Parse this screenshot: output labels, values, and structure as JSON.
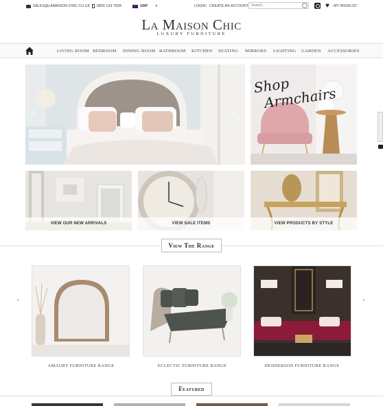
{
  "topbar": {
    "email": "sales@lamaison-chic.co.uk",
    "separator": "|",
    "phone": "0800 133 7828",
    "currency": "GBP",
    "currency_caret": "▾",
    "login": "Login",
    "create_account": "Create An Account",
    "search_placeholder": "Search...",
    "wishlist": "My Wishlist"
  },
  "logo": {
    "title": "La Maison Chic",
    "subtitle": "Luxury Furniture"
  },
  "nav": {
    "items": [
      "Living Room",
      "Bedroom",
      "Dining Room",
      "Bathroom",
      "Kitchen",
      "Seating",
      "Mirrors",
      "Lighting",
      "Garden",
      "Accessories"
    ]
  },
  "hero": {
    "prev_arrow": "‹",
    "next_arrow": "›"
  },
  "promo": {
    "armchairs_line1": "Shop",
    "armchairs_line2": "Armchairs"
  },
  "tiles": [
    {
      "label": "View our new arrivals"
    },
    {
      "label": "View sale items"
    },
    {
      "label": "View products by style"
    }
  ],
  "view_range": {
    "title": "View The Range",
    "prev": "‹",
    "next": "›",
    "cards": [
      {
        "label": "Amaury Furniture Range"
      },
      {
        "label": "Eclectic Furniture Range"
      },
      {
        "label": "Henderson Furniture Range"
      }
    ]
  },
  "featured": {
    "title": "Featured"
  }
}
